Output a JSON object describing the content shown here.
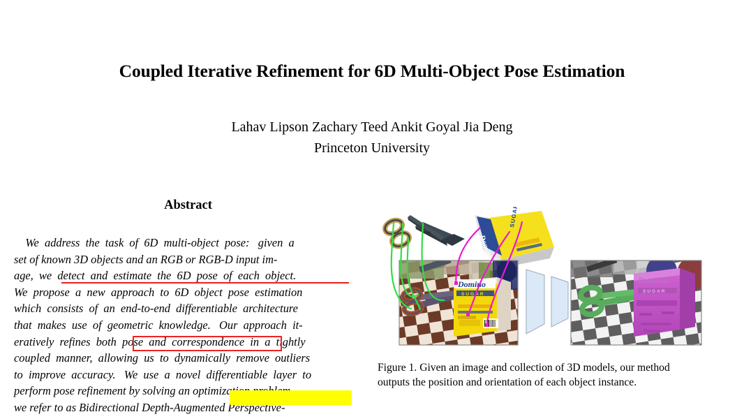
{
  "paper": {
    "title": "Coupled Iterative Refinement for 6D Multi-Object Pose Estimation",
    "authors": {
      "names": "Lahav Lipson      Zachary Teed      Ankit Goyal      Jia Deng",
      "affiliation": "Princeton University"
    },
    "abstract": {
      "heading": "Abstract",
      "lines": [
        "    We  address  the  task  of  6D  multi-object  pose:   given  a",
        "set of known 3D objects and an RGB or RGB-D input im-",
        "age,  we  detect  and  estimate  the  6D  pose  of  each  object.",
        "We  propose  a  new  approach  to  6D  object  pose  estimation",
        "which  consists  of  an  end-to-end  differentiable  architecture",
        "that  makes  use  of  geometric  knowledge.   Our  approach  it-",
        "eratively  refines  both  pose  and  correspondence  in  a  tightly",
        "coupled  manner,  allowing  us  to  dynamically  remove  outliers",
        "to  improve  accuracy.   We  use  a  novel  differentiable  layer  to",
        "perform pose refinement by solving an optimization problem",
        "we refer to as Bidirectional Depth-Augmented Perspective-"
      ]
    },
    "annotations": {
      "underline_text": "detect and estimate the 6D pose of each object.",
      "underline_color": "#e8201c",
      "boxed_text": "pose and correspondence",
      "box_color": "#ee2222",
      "highlighted_text": "optimization problem",
      "highlight_color": "#ffff00"
    }
  },
  "figure": {
    "caption_lines": [
      "Figure 1. Given an image and collection of 3D models, our method",
      "outputs the position and orientation of each object instance."
    ],
    "labels": {
      "model_scissors": "scissors-3d-model",
      "model_sugar_box": "sugar-box-3d-model",
      "input_photo": "input-rgb-image",
      "network": "network-block",
      "output_photo": "output-pose-overlay-image"
    },
    "box_brand": "Domino",
    "box_sub": "SUGAR",
    "colors": {
      "correspondence_green": "#33dd44",
      "correspondence_magenta": "#e81ad0",
      "network_fill": "#dbe8f7",
      "network_stroke": "#9aa9b8",
      "scissors_overlay": "#5cb860",
      "box_overlay": "#c455c8",
      "sugar_yellow": "#f2d90b",
      "domino_blue": "#1e3a8a"
    }
  }
}
